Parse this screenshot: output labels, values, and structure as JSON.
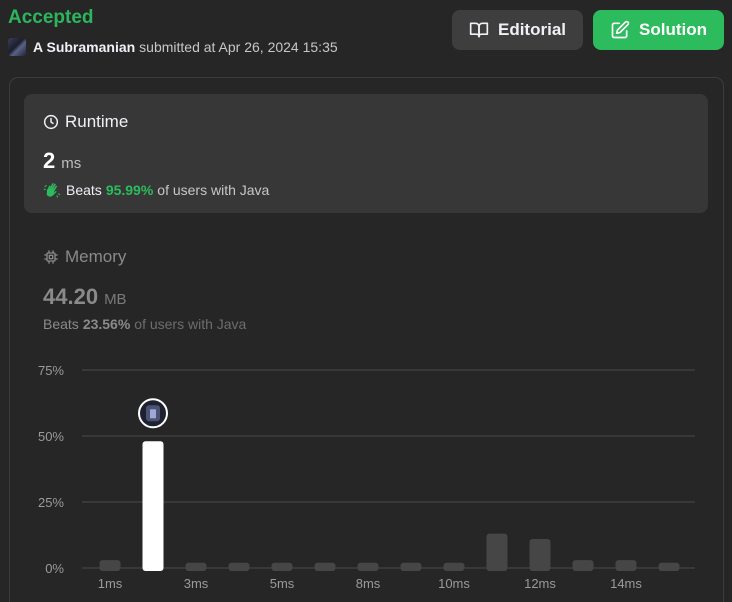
{
  "header": {
    "status": "Accepted",
    "user_name": "A Subramanian",
    "submitted_text": "submitted at Apr 26, 2024 15:35",
    "editorial_label": "Editorial",
    "solution_label": "Solution"
  },
  "runtime": {
    "title": "Runtime",
    "value": "2",
    "unit": "ms",
    "beats_label": "Beats",
    "beats_pct": "95.99%",
    "beats_suffix": "of users with Java"
  },
  "memory": {
    "title": "Memory",
    "value": "44.20",
    "unit": "MB",
    "beats_label": "Beats",
    "beats_pct": "23.56%",
    "beats_suffix": "of users with Java"
  },
  "colors": {
    "accent_green": "#2cbb5d",
    "bar_highlight": "#ffffff",
    "bar_default": "#464646",
    "grid": "#4a4a4a"
  },
  "chart_data": {
    "type": "bar",
    "y_ticks": [
      "75%",
      "50%",
      "25%",
      "0%"
    ],
    "x_tick_labels": [
      "1ms",
      "3ms",
      "5ms",
      "8ms",
      "10ms",
      "12ms",
      "14ms"
    ],
    "ylim": [
      0,
      75
    ],
    "bar_values": [
      3,
      48,
      2,
      2,
      2,
      2,
      2,
      2,
      2,
      13,
      11,
      3,
      3,
      2
    ],
    "highlight_index": 1,
    "grid": true
  }
}
